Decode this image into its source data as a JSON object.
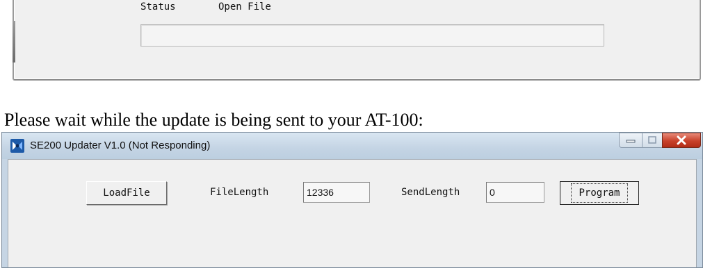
{
  "top_dialog": {
    "status_label": "Status",
    "status_value": "Open File",
    "progress_value": 0
  },
  "instruction": ". Please wait while the update is being sent to your AT-100:",
  "window": {
    "title": "SE200 Updater V1.0 (Not Responding)",
    "icon": "app-logo-icon",
    "controls": [
      "minimize-icon",
      "maximize-icon",
      "close-icon"
    ],
    "load_file_label": "LoadFile",
    "file_length_label": "FileLength",
    "file_length_value": "12336",
    "send_length_label": "SendLength",
    "send_length_value": "0",
    "program_label": "Program"
  },
  "colors": {
    "titlebar": "#c6d5e4",
    "close_button": "#c8412a",
    "dialog_face": "#f0f0f0"
  }
}
